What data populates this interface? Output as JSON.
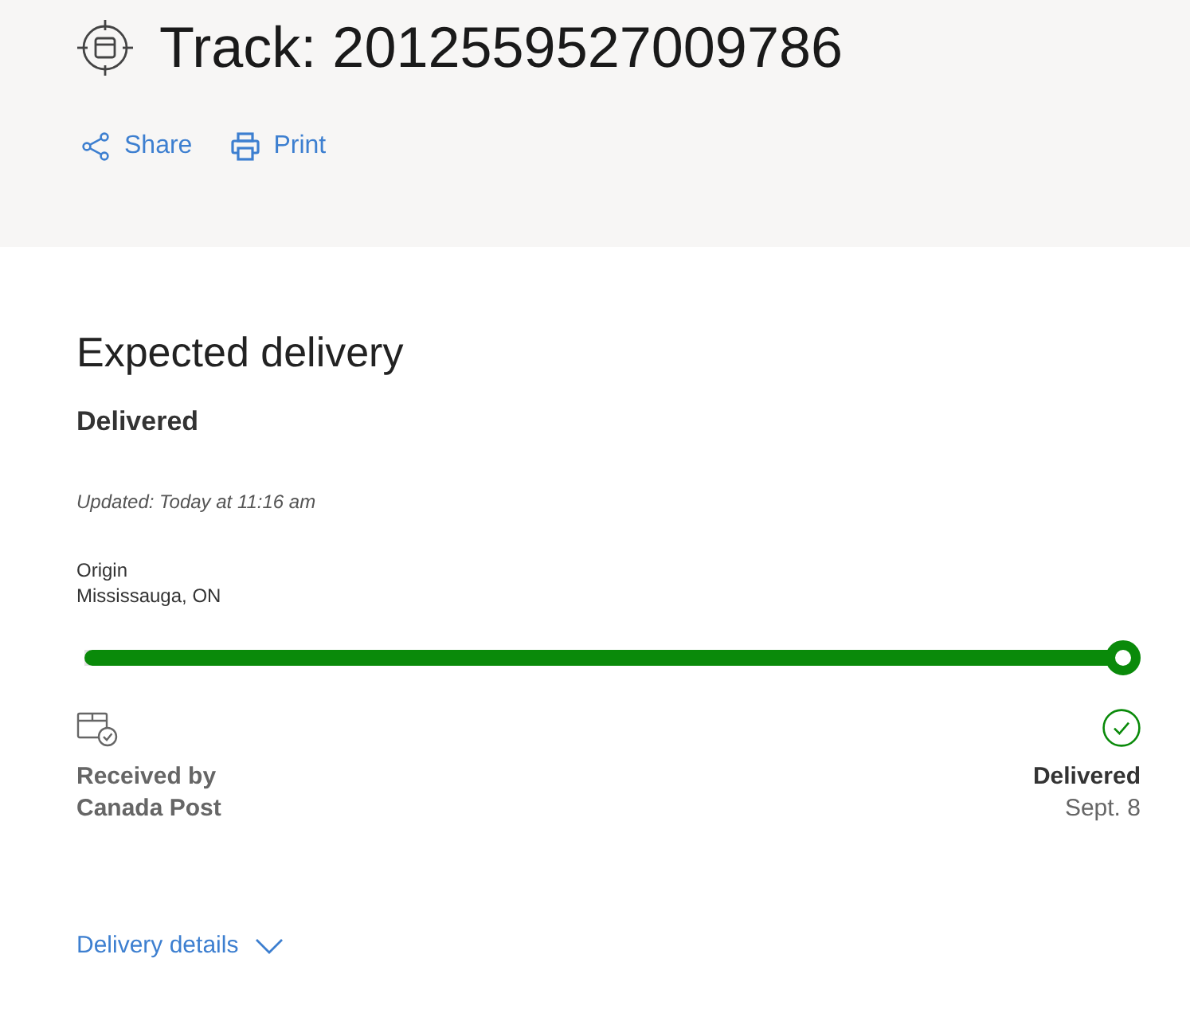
{
  "header": {
    "title": "Track: 2012559527009786",
    "actions": [
      {
        "kind": "share",
        "label": "Share"
      },
      {
        "kind": "print",
        "label": "Print"
      }
    ]
  },
  "summary": {
    "heading": "Expected delivery",
    "status": "Delivered",
    "updated": "Updated: Today at 11:16 am",
    "origin": {
      "label": "Origin",
      "value": "Mississauga, ON"
    }
  },
  "progress": {
    "level": 1
  },
  "milestones": [
    {
      "kind": "received",
      "title": "Received by Canada Post"
    },
    {
      "kind": "delivered",
      "title": "Delivered",
      "date": "Sept. 8"
    }
  ],
  "details": {
    "label": "Delivery details",
    "expanded": false
  }
}
